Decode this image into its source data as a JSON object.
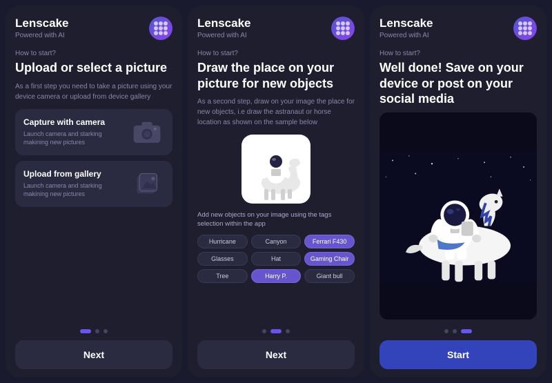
{
  "screens": [
    {
      "id": "screen-1",
      "brand": "Lenscake",
      "powered": "Powered with AI",
      "how_to_start": "How to start?",
      "heading": "Upload or select a picture",
      "description": "As a first step you need to take a picture using your device camera or upload from device gallery",
      "options": [
        {
          "title": "Capture with camera",
          "description": "Launch camera and starking makining new pictures",
          "icon": "camera"
        },
        {
          "title": "Upload from gallery",
          "description": "Launch camera and starking makining new pictures",
          "icon": "gallery"
        }
      ],
      "pagination": [
        true,
        false,
        false
      ],
      "button_label": "Next",
      "button_type": "next"
    },
    {
      "id": "screen-2",
      "brand": "Lenscake",
      "powered": "Powered with AI",
      "how_to_start": "How to start?",
      "heading": "Draw the place on your picture for new objects",
      "description": "As a second step, draw on your image the place for new objects, i.e draw the astranaut or horse location as shown on the sample below",
      "tags_label": "Add new objects on your image using the tags selection within the app",
      "tags": [
        {
          "label": "Hurricane",
          "active": false
        },
        {
          "label": "Canyon",
          "active": false
        },
        {
          "label": "Ferrari F430",
          "active": true
        },
        {
          "label": "Glasses",
          "active": false
        },
        {
          "label": "Hat",
          "active": false
        },
        {
          "label": "Gaming Chair",
          "active": true
        },
        {
          "label": "Tree",
          "active": false
        },
        {
          "label": "Harry P.",
          "active": true
        },
        {
          "label": "Giant bull",
          "active": false
        }
      ],
      "pagination": [
        false,
        true,
        false
      ],
      "button_label": "Next",
      "button_type": "next"
    },
    {
      "id": "screen-3",
      "brand": "Lenscake",
      "powered": "Powered with AI",
      "how_to_start": "How to start?",
      "heading": "Well done! Save on your device or post on your social media",
      "pagination": [
        false,
        false,
        true
      ],
      "button_label": "Start",
      "button_type": "start"
    }
  ]
}
